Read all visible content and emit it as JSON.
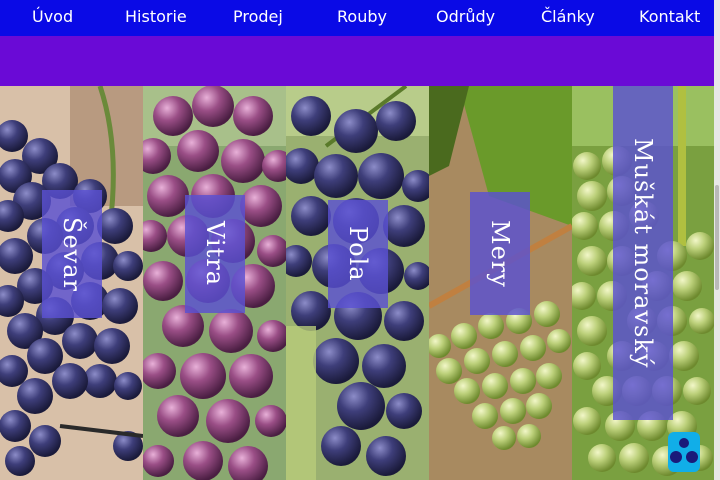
{
  "nav": {
    "items": [
      "Úvod",
      "Historie",
      "Prodej",
      "Rouby",
      "Odrůdy",
      "Články",
      "Kontakt"
    ]
  },
  "varieties": [
    {
      "name": "Ševar",
      "grape": "blue"
    },
    {
      "name": "Vitra",
      "grape": "red"
    },
    {
      "name": "Pola",
      "grape": "blue"
    },
    {
      "name": "Mery",
      "grape": "green"
    },
    {
      "name": "Muškát moravský",
      "grape": "green"
    }
  ],
  "colors": {
    "nav_bg": "#0a0ae6",
    "band_bg": "#6a0ad6",
    "label_bg": "#5a50d2",
    "fab_bg": "#11aee8"
  },
  "fab": {
    "icon": "app-logo-icon"
  }
}
